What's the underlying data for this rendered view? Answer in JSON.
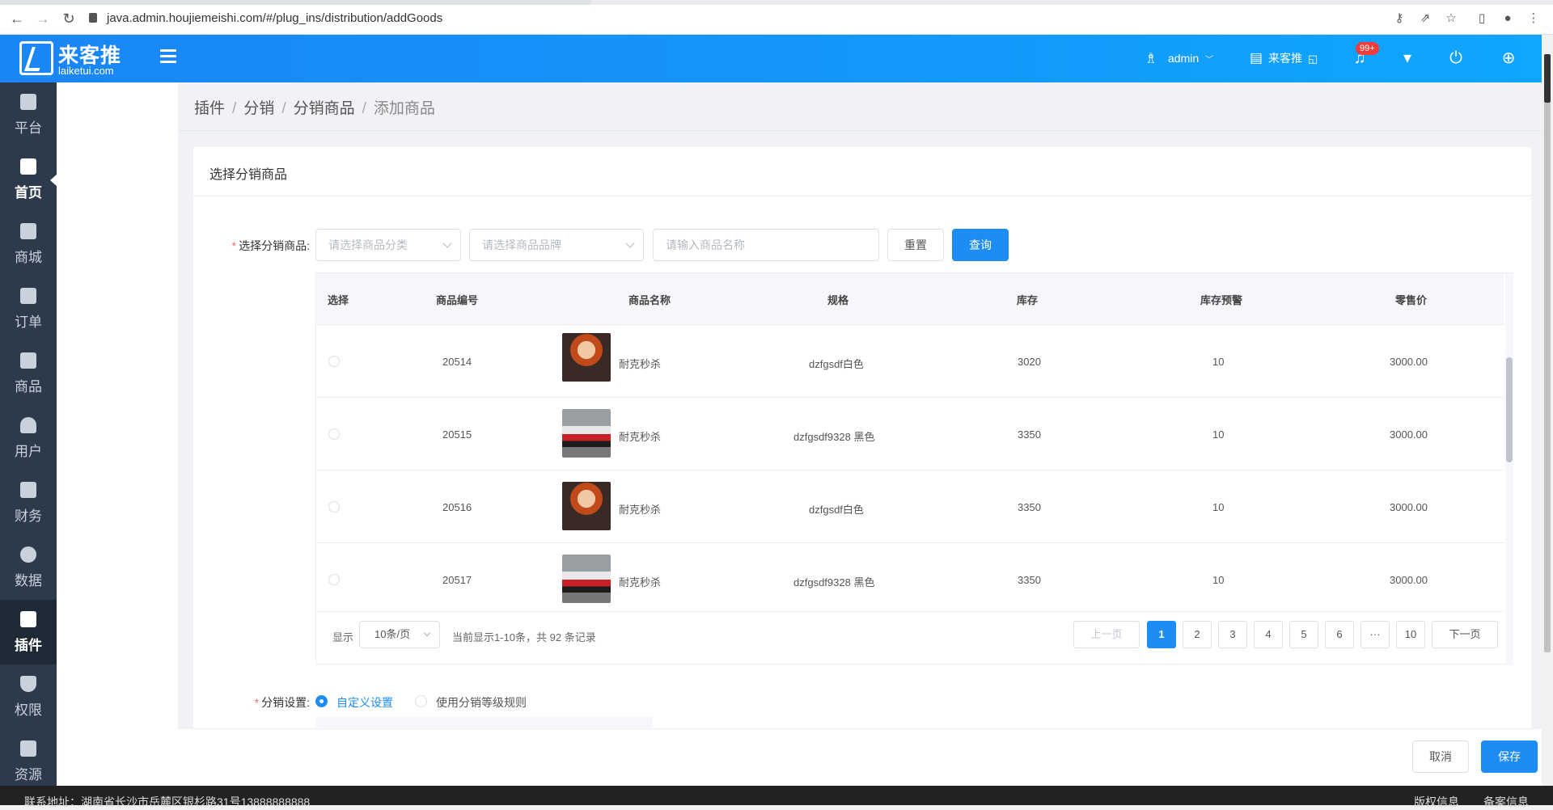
{
  "browser": {
    "url": "java.admin.houjiemeishi.com/#/plug_ins/distribution/addGoods",
    "back_glyph": "←",
    "forward_glyph": "→",
    "reload_glyph": "↻",
    "key_glyph": "⚷",
    "share_glyph": "⇗",
    "star_glyph": "☆",
    "sidepanel_glyph": "▯",
    "profile_glyph": "●",
    "menu_glyph": "⋮"
  },
  "header": {
    "logo_title": "来客推",
    "logo_sub": "laiketui.com",
    "user_name": "admin",
    "user_icon": "♗",
    "user_caret": "﹀",
    "store_name": "来客推",
    "store_icon": "▤",
    "store_edit_icon": "◱",
    "bell_icon": "♫",
    "notification_count": "99+",
    "shirt_icon": "▾",
    "power_icon": "⏻",
    "globe_icon": "⊕"
  },
  "sidebar": {
    "items": [
      {
        "label": "平台"
      },
      {
        "label": "首页"
      },
      {
        "label": "商城"
      },
      {
        "label": "订单"
      },
      {
        "label": "商品"
      },
      {
        "label": "用户"
      },
      {
        "label": "财务"
      },
      {
        "label": "数据"
      },
      {
        "label": "插件"
      },
      {
        "label": "权限"
      },
      {
        "label": "资源"
      }
    ]
  },
  "breadcrumb": {
    "items": [
      "插件",
      "分销",
      "分销商品",
      "添加商品"
    ],
    "separator": "/"
  },
  "card": {
    "title": "选择分销商品",
    "filter_label": "选择分销商品:",
    "category_placeholder": "请选择商品分类",
    "brand_placeholder": "请选择商品品牌",
    "name_placeholder": "请输入商品名称",
    "reset_label": "重置",
    "query_label": "查询"
  },
  "table": {
    "columns": [
      "选择",
      "商品编号",
      "商品名称",
      "规格",
      "库存",
      "库存预警",
      "零售价"
    ],
    "rows": [
      {
        "id": "20514",
        "name": "耐克秒杀",
        "spec": "dzfgsdf白色",
        "stock": "3020",
        "warn": "10",
        "price": "3000.00"
      },
      {
        "id": "20515",
        "name": "耐克秒杀",
        "spec": "dzfgsdf9328 黑色",
        "stock": "3350",
        "warn": "10",
        "price": "3000.00"
      },
      {
        "id": "20516",
        "name": "耐克秒杀",
        "spec": "dzfgsdf白色",
        "stock": "3350",
        "warn": "10",
        "price": "3000.00"
      },
      {
        "id": "20517",
        "name": "耐克秒杀",
        "spec": "dzfgsdf9328 黑色",
        "stock": "3350",
        "warn": "10",
        "price": "3000.00"
      }
    ]
  },
  "pagination": {
    "show_label": "显示",
    "page_size": "10条/页",
    "summary": "当前显示1-10条，共 92 条记录",
    "prev_label": "上一页",
    "next_label": "下一页",
    "pages": [
      "1",
      "2",
      "3",
      "4",
      "5",
      "6",
      "···",
      "10"
    ],
    "current_page": "1"
  },
  "distribution": {
    "label": "分销设置:",
    "option_custom": "自定义设置",
    "option_level": "使用分销等级规则"
  },
  "actions": {
    "cancel_label": "取消",
    "save_label": "保存"
  },
  "footer": {
    "address": "联系地址：湖南省长沙市岳麓区银杉路31号13888888888",
    "copyright": "版权信息",
    "record": "备案信息"
  },
  "colors": {
    "primary": "#1e8cf5",
    "header_gradient_start": "#1a85f7",
    "header_gradient_end": "#0fa6ff",
    "sidebar_bg": "#2d3a4b",
    "required": "#f56c6c",
    "badge": "#f23c3c"
  }
}
